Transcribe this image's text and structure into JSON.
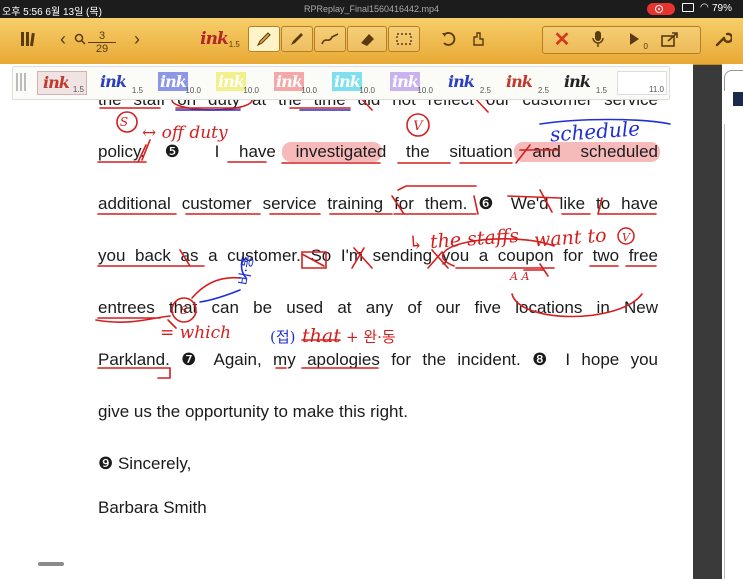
{
  "status_bar": {
    "time": "오후 5:56  6월 13일 (목)",
    "title": "RPReplay_Final1560416442.mp4",
    "battery": "79%"
  },
  "toolbar": {
    "page_current": "3",
    "page_total": "29",
    "ink_label": "ink",
    "ink_size": "1.5",
    "icons": [
      "library-icon",
      "prev-page-icon",
      "search-icon",
      "next-page-icon",
      "ink-settings-icon",
      "pen-icon",
      "marker-icon",
      "brush-icon",
      "eraser-icon",
      "lasso-select-icon",
      "undo-icon",
      "pointer-icon",
      "close-icon",
      "mic-icon",
      "play-icon",
      "share-icon",
      "wrench-icon"
    ]
  },
  "pens": [
    {
      "label": "ink",
      "size": "1.5",
      "color": "#c0392b"
    },
    {
      "label": "ink",
      "size": "1.5",
      "color": "#2b3fc0"
    },
    {
      "label": "ink",
      "size": "10.0",
      "color": "#8c97e8"
    },
    {
      "label": "ink",
      "size": "10.0",
      "color": "#f3ef8a"
    },
    {
      "label": "ink",
      "size": "10.0",
      "color": "#f5a8a8"
    },
    {
      "label": "ink",
      "size": "10.0",
      "color": "#7ee0ef"
    },
    {
      "label": "ink",
      "size": "10.0",
      "color": "#c9b3ef"
    },
    {
      "label": "ink",
      "size": "2.5",
      "color": "#2b3fc0"
    },
    {
      "label": "ink",
      "size": "2.5",
      "color": "#c0392b"
    },
    {
      "label": "ink",
      "size": "1.5",
      "color": "#222222"
    },
    {
      "label": "",
      "size": "11.0",
      "color": "#ffffff"
    }
  ],
  "document": {
    "line_partial": "the staff on duty at the time did not reflect our customer service",
    "line_1": "policy.  ❺  I  have  investigated  the  situation  and  scheduled",
    "line_2": "additional  customer  service  training  for  them.  ❻  We'd  like  to  have",
    "line_3": "you  back  as  a  customer.  So  I'm  sending  you  a  coupon  for  two  free",
    "line_4": "entrees  that  can  be  used  at  any  of  our  five  locations  in  New",
    "line_5": "Parkland.  ❼  Again,  my  apologies  for  the  incident.  ❽  I  hope  you",
    "line_6": "give  us  the  opportunity  to  make  this  right.",
    "line_7": "❾  Sincerely,",
    "line_8": "Barbara  Smith"
  },
  "handwriting": {
    "s_mark": "S",
    "off_duty": "↔ off duty",
    "v_mark": "V",
    "schedule": "schedule",
    "the_staffs": "↳ the staffs",
    "want_to": "want to",
    "circled_v": "V",
    "aa": "A A",
    "korean_1": "비·동",
    "s_mark_2": "S",
    "which": "= which",
    "that_note_prefix": "(접)",
    "that_note_word": "that",
    "that_note_suffix": "+ 완·동",
    "colors": {
      "red": "#d41f1f",
      "blue": "#1f2fd4",
      "pink_highlight": "#f4a3a3"
    }
  }
}
